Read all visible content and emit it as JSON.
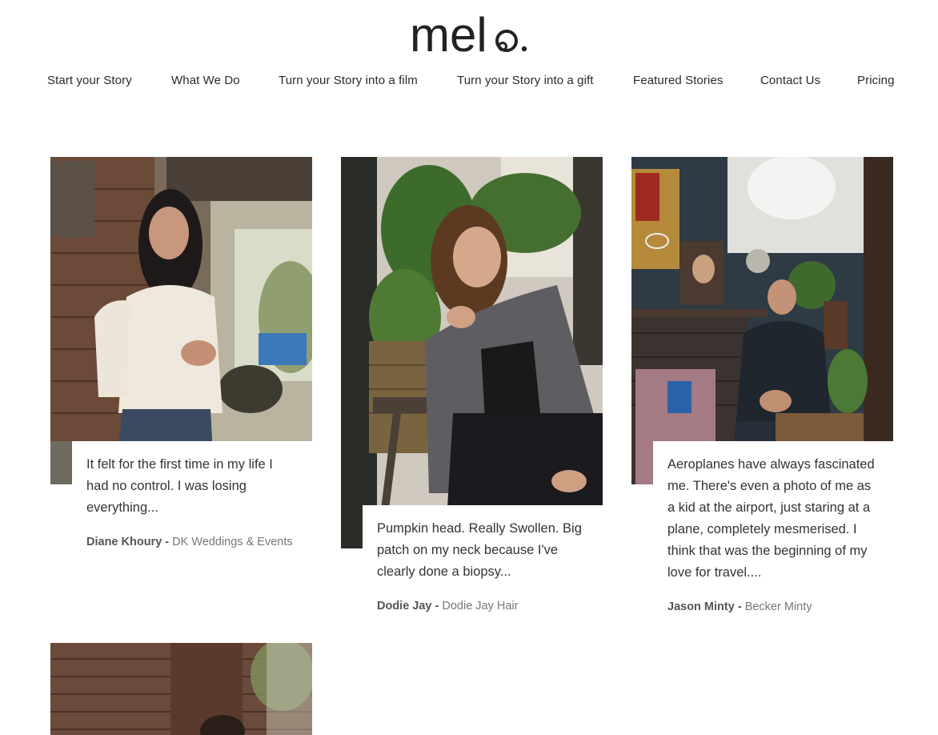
{
  "brand": {
    "logo_text": "melo."
  },
  "nav": {
    "items": [
      "Start your Story",
      "What We Do",
      "Turn your Story into a film",
      "Turn your Story into a gift",
      "Featured Stories",
      "Contact Us",
      "Pricing"
    ]
  },
  "stories": [
    {
      "quote": "It felt for the first time in my life I had no control. I was losing everything...",
      "name": "Diane Khoury",
      "separator": " - ",
      "business": "DK Weddings & Events"
    },
    {
      "quote": "Pumpkin head. Really Swollen. Big patch on my neck because I've clearly done a biopsy...",
      "name": "Dodie Jay",
      "separator": " - ",
      "business": "Dodie Jay Hair"
    },
    {
      "quote": "Aeroplanes have always fascinated me. There's even a photo of me as a kid at the airport, just staring at a plane, completely mesmerised. I think that was the beginning of my love for travel....",
      "name": "Jason Minty",
      "separator": " - ",
      "business": "Becker Minty"
    }
  ]
}
